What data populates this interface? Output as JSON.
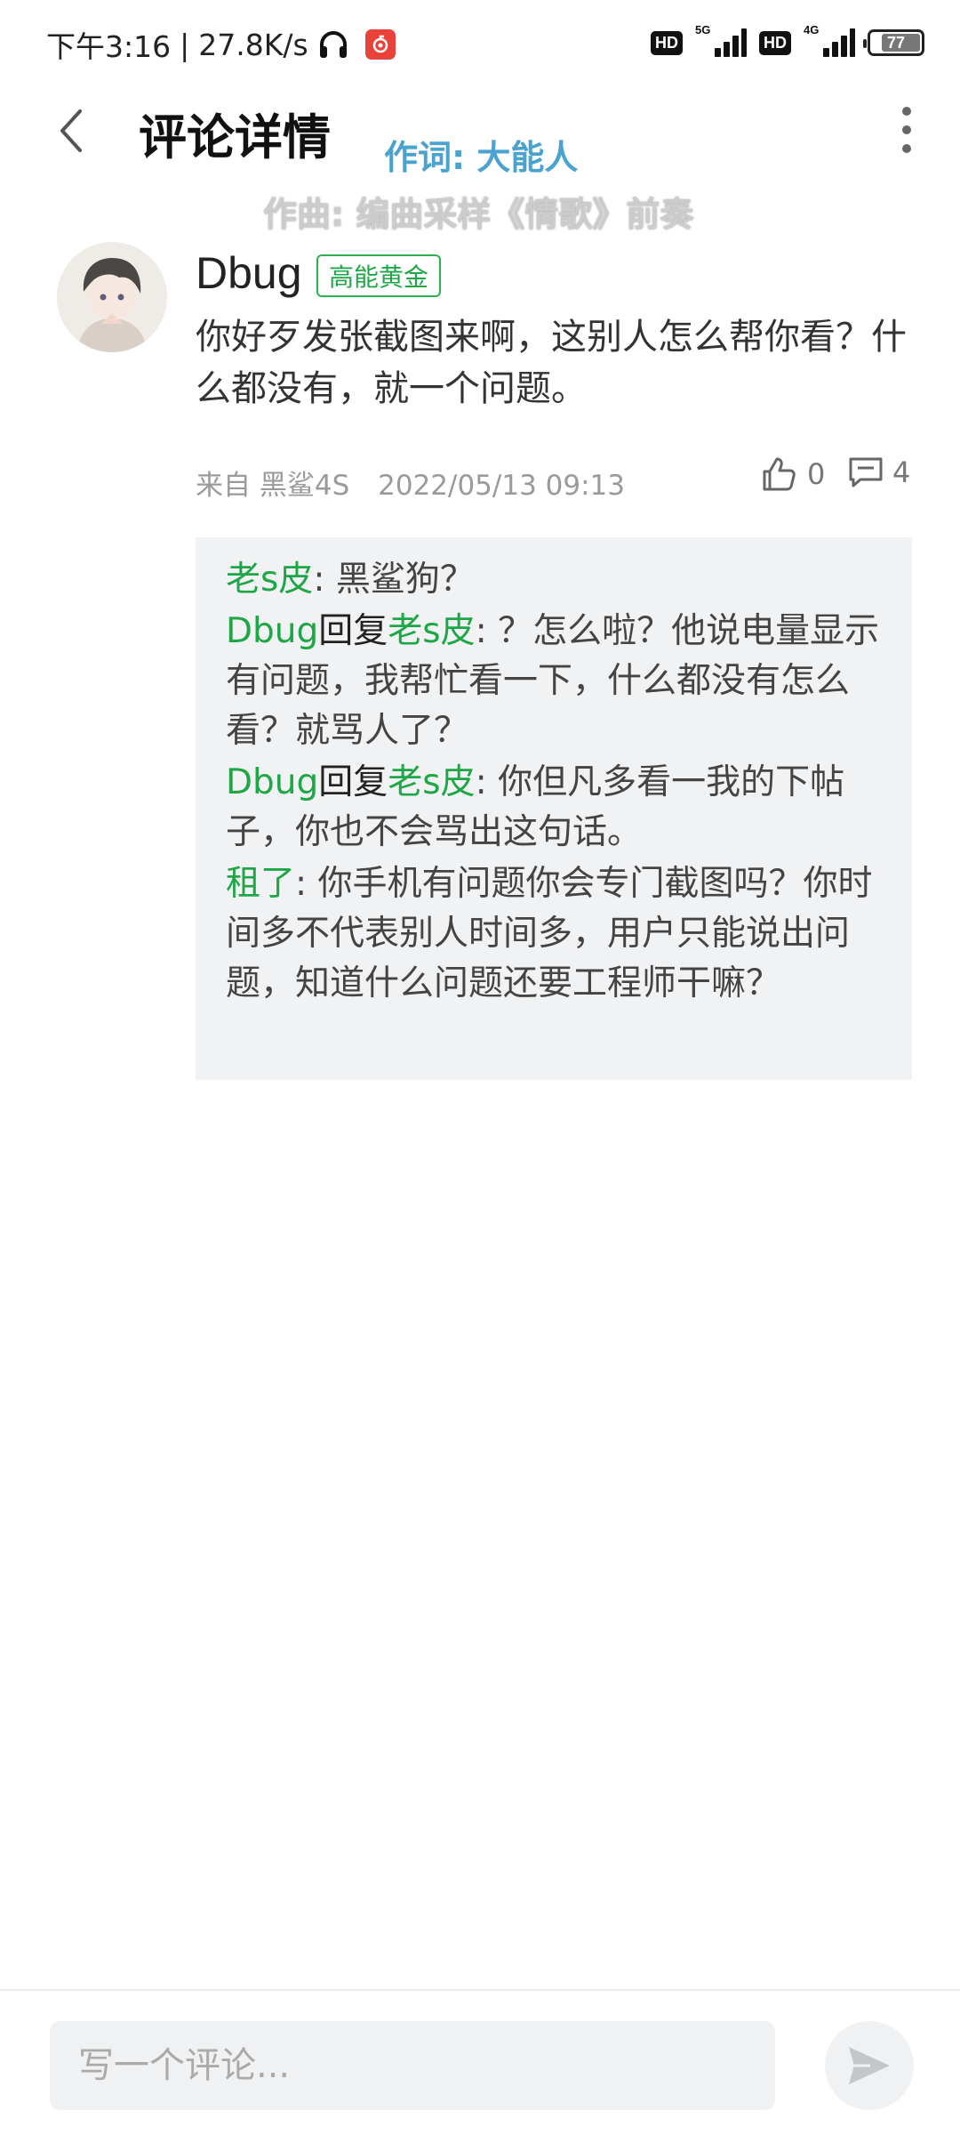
{
  "status_bar": {
    "time": "下午3:16",
    "separator": "|",
    "net_speed": "27.8K/s",
    "net_type_1": "5G",
    "net_type_2": "4G",
    "hd_label": "HD",
    "battery": "77",
    "battery_level": 0.77,
    "icons": [
      "headphone-icon",
      "music-app-icon",
      "signal-icon",
      "battery-icon"
    ]
  },
  "header": {
    "title": "评论详情",
    "lyric_line_1": "作词: 大能人",
    "lyric_line_2": "作曲: 编曲采样《情歌》前奏"
  },
  "comment": {
    "username": "Dbug",
    "level": "高能黄金",
    "text": "你好歹发张截图来啊，这别人怎么帮你看？什么都没有，就一个问题。",
    "source": "来自 黑鲨4S",
    "time": "2022/05/13 09:13",
    "likes": "0",
    "replies_count": "4"
  },
  "replies": [
    {
      "name": "老s皮",
      "verb": "",
      "target": "",
      "text": ": 黑鲨狗？"
    },
    {
      "name": "Dbug",
      "verb": "回复",
      "target": "老s皮",
      "text": ": ？怎么啦？他说电量显示有问题，我帮忙看一下，什么都没有怎么看？就骂人了？"
    },
    {
      "name": "Dbug",
      "verb": "回复",
      "target": "老s皮",
      "text": ": 你但凡多看一我的下帖子，你也不会骂出这句话。"
    },
    {
      "name": "租了",
      "verb": "",
      "target": "",
      "text": ": 你手机有问题你会专门截图吗？你时间多不代表别人时间多，用户只能说出问题，知道什么问题还要工程师干嘛？"
    }
  ],
  "input": {
    "placeholder": "写一个评论..."
  },
  "colors": {
    "accent_green": "#1fa647",
    "lyric_blue": "#4aa3cf",
    "reply_bg": "#f1f2f4"
  }
}
